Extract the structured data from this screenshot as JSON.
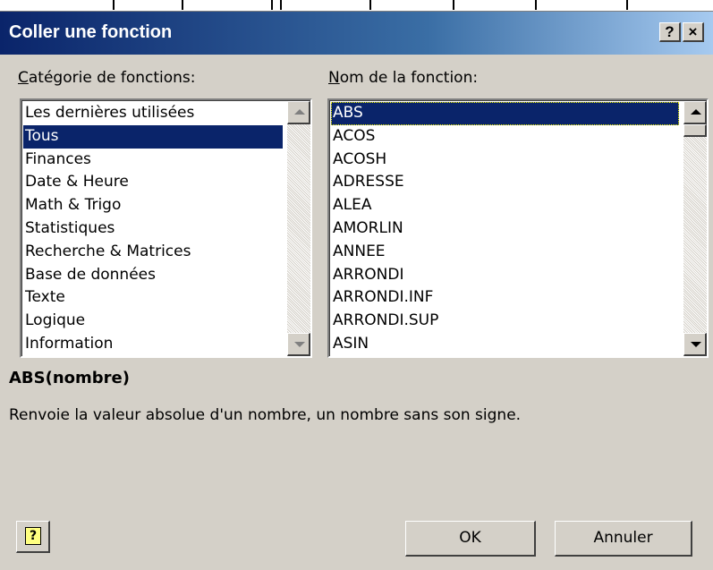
{
  "dialog": {
    "title": "Coller une fonction",
    "help_title_button": "?",
    "close_title_button": "×"
  },
  "category": {
    "label": "Catégorie de fonctions:",
    "items": [
      "Les dernières utilisées",
      "Tous",
      "Finances",
      "Date & Heure",
      "Math & Trigo",
      "Statistiques",
      "Recherche & Matrices",
      "Base de données",
      "Texte",
      "Logique",
      "Information"
    ],
    "selected_index": 1
  },
  "functions": {
    "label": "Nom de la fonction:",
    "items": [
      "ABS",
      "ACOS",
      "ACOSH",
      "ADRESSE",
      "ALEA",
      "AMORLIN",
      "ANNEE",
      "ARRONDI",
      "ARRONDI.INF",
      "ARRONDI.SUP",
      "ASIN"
    ],
    "selected_index": 0
  },
  "details": {
    "syntax": "ABS(nombre)",
    "description": "Renvoie la valeur absolue d'un nombre, un nombre sans son signe."
  },
  "buttons": {
    "help_glyph": "?",
    "ok": "OK",
    "cancel": "Annuler"
  },
  "colors": {
    "dialog_bg": "#d4d0c8",
    "title_gradient_start": "#0a246a",
    "selection": "#0a246a"
  }
}
